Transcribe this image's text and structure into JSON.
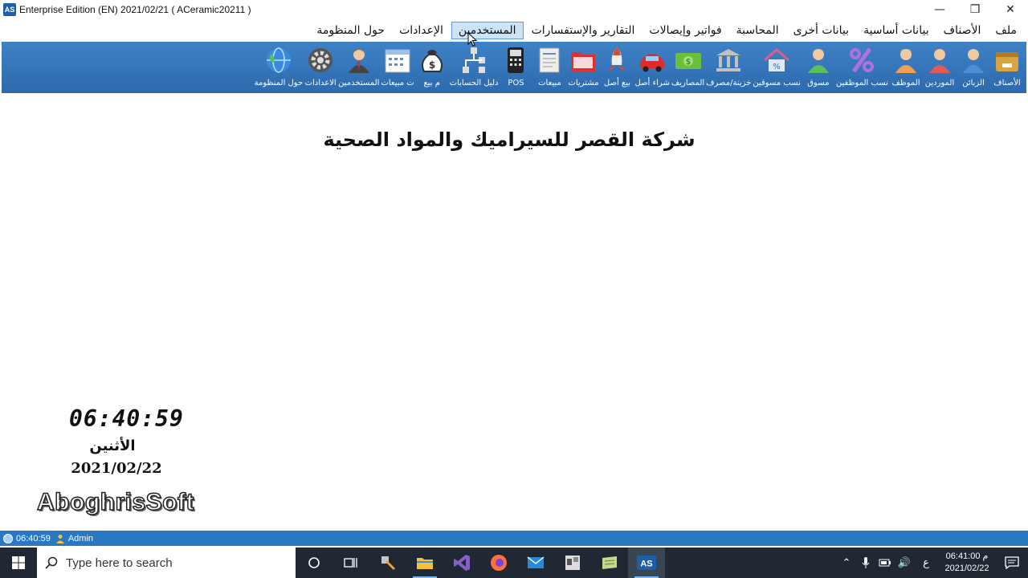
{
  "window": {
    "app_icon_text": "AS",
    "title": "Enterprise Edition (EN) 2021/02/21  ( ACeramic20211 )"
  },
  "menu": [
    {
      "label": "ملف",
      "active": false
    },
    {
      "label": "الأصناف",
      "active": false
    },
    {
      "label": "بيانات أساسية",
      "active": false
    },
    {
      "label": "بيانات أخرى",
      "active": false
    },
    {
      "label": "المحاسبة",
      "active": false
    },
    {
      "label": "فواتير وإيصالات",
      "active": false
    },
    {
      "label": "التقارير والإستفسارات",
      "active": false
    },
    {
      "label": "المستخدمين",
      "active": true
    },
    {
      "label": "الإعدادات",
      "active": false
    },
    {
      "label": "حول المنظومة",
      "active": false
    }
  ],
  "toolbar": [
    {
      "label": "الأصناف",
      "icon": "box-icon",
      "color": "#d9a441"
    },
    {
      "label": "الزبائن",
      "icon": "customer-icon",
      "color": "#4a90d9"
    },
    {
      "label": "الموردين",
      "icon": "supplier-icon",
      "color": "#e05a5a"
    },
    {
      "label": "الموظف",
      "icon": "employee-icon",
      "color": "#f0a050"
    },
    {
      "label": "نسب الموظفين",
      "icon": "percent-icon",
      "color": "#b070e0"
    },
    {
      "label": "مسوق",
      "icon": "marketer-icon",
      "color": "#5bbf5b"
    },
    {
      "label": "نسب مسوقين",
      "icon": "house-percent-icon",
      "color": "#e05a8a"
    },
    {
      "label": "خزينة/مصرف",
      "icon": "bank-icon",
      "color": "#c0c0c0"
    },
    {
      "label": "المصاريف",
      "icon": "money-icon",
      "color": "#6bbf3b"
    },
    {
      "label": "شراء أصل",
      "icon": "car-icon",
      "color": "#e02a2a"
    },
    {
      "label": "بيع أصل",
      "icon": "rocket-icon",
      "color": "#d05030"
    },
    {
      "label": "مشتريات",
      "icon": "purchase-folder-icon",
      "color": "#e03030"
    },
    {
      "label": "مبيعات",
      "icon": "sales-document-icon",
      "color": "#eeeeee"
    },
    {
      "label": "POS",
      "icon": "pos-terminal-icon",
      "color": "#222222"
    },
    {
      "label": "دليل الحسابات",
      "icon": "accounts-tree-icon",
      "color": "#dddddd"
    },
    {
      "label": "م بيع",
      "icon": "money-bag-icon",
      "color": "#333333"
    },
    {
      "label": "ت مبيعات",
      "icon": "calendar-icon",
      "color": "#ffffff"
    },
    {
      "label": "المستخدمين",
      "icon": "users-icon",
      "color": "#8a5a3a"
    },
    {
      "label": "الاعدادات",
      "icon": "settings-gear-icon",
      "color": "#888888"
    },
    {
      "label": "حول المنظومة",
      "icon": "globe-icon",
      "color": "#3a8ae0"
    }
  ],
  "main": {
    "company_name": "شركة القصر للسيراميك والمواد الصحية",
    "clock": "06:40:59",
    "day_name": "الأثنين",
    "date": "2021/02/22",
    "brand": "AboghrisSoft"
  },
  "status_bar": {
    "time": "06:40:59",
    "user": "Admin"
  },
  "taskbar": {
    "search_placeholder": "Type here to search",
    "lang": "ع",
    "clock_time": "06:41:00 م",
    "clock_date": "2021/02/22"
  }
}
